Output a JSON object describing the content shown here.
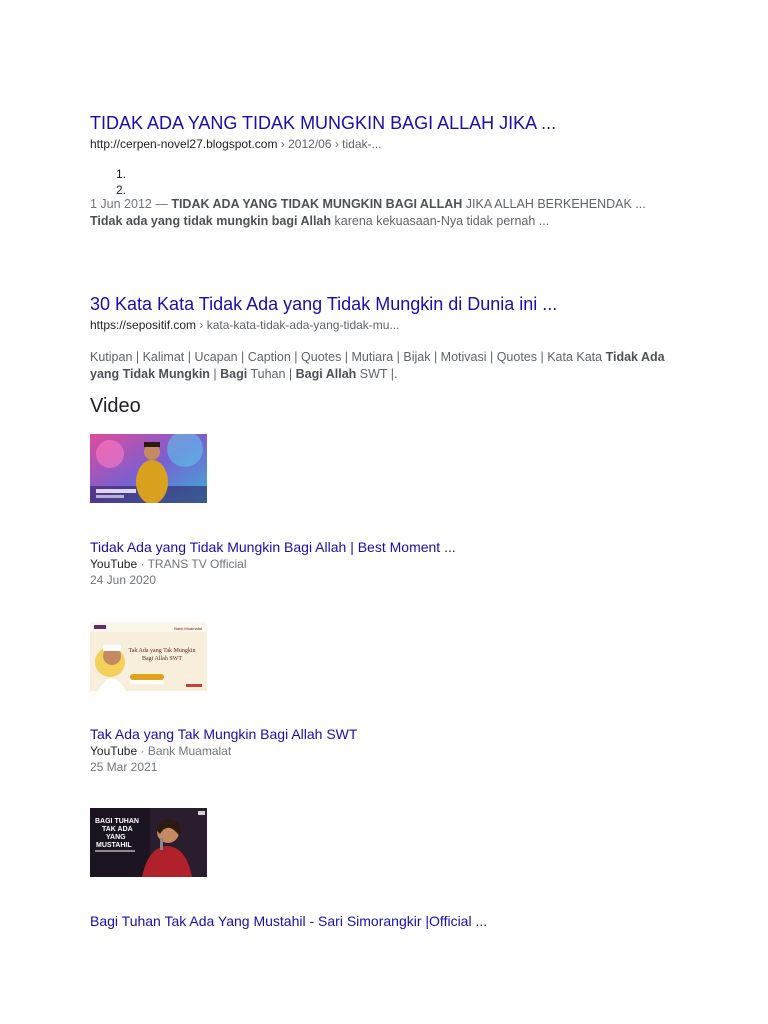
{
  "results": [
    {
      "title": "TIDAK ADA YANG TIDAK MUNGKIN BAGI ALLAH JIKA ...",
      "url_host": "http://cerpen-novel27.blogspot.com",
      "url_path": " › 2012/06 › tidak-...",
      "list_items": [
        "1.",
        "2."
      ],
      "date": "1 Jun 2012 — ",
      "snippet_parts": [
        {
          "t": "TIDAK ADA YANG TIDAK MUNGKIN BAGI ALLAH",
          "b": true
        },
        {
          "t": " JIKA ALLAH BERKEHENDAK ... ",
          "b": false
        },
        {
          "t": "Tidak ada yang tidak mungkin bagi Allah",
          "b": true
        },
        {
          "t": " karena kekuasaan-Nya tidak pernah ...",
          "b": false
        }
      ]
    },
    {
      "title": "30 Kata Kata Tidak Ada yang Tidak Mungkin di Dunia ini ...",
      "url_host": "https://sepositif.com",
      "url_path": " › kata-kata-tidak-ada-yang-tidak-mu...",
      "snippet_parts": [
        {
          "t": "Kutipan | Kalimat | Ucapan | Caption | Quotes | Mutiara | Bijak | Motivasi | Quotes | Kata Kata ",
          "b": false
        },
        {
          "t": "Tidak Ada yang Tidak Mungkin",
          "b": true
        },
        {
          "t": " | ",
          "b": false
        },
        {
          "t": "Bagi",
          "b": true
        },
        {
          "t": " Tuhan | ",
          "b": false
        },
        {
          "t": "Bagi Allah",
          "b": true
        },
        {
          "t": " SWT |.",
          "b": false
        }
      ]
    }
  ],
  "video_section": {
    "heading": "Video",
    "videos": [
      {
        "title": "Tidak Ada yang Tidak Mungkin Bagi Allah | Best Moment ...",
        "site": "YouTube",
        "channel": " · TRANS TV Official",
        "date": "24 Jun 2020",
        "thumb_colors": {
          "bg": "#c73b8a",
          "accent": "#3ab0d6",
          "figure": "#d9a21e"
        }
      },
      {
        "title": "Tak Ada yang Tak Mungkin Bagi Allah SWT",
        "site": "YouTube",
        "channel": " · Bank Muamalat",
        "date": "25 Mar 2021",
        "thumb_text": [
          "Tak Ada yang Tak Mungkin",
          "Bagi Allah SWT"
        ],
        "thumb_brand": "Bank Muamalat",
        "thumb_colors": {
          "bg": "#f7eedb",
          "accent": "#e0a21a",
          "figure": "#6b2a2a"
        }
      },
      {
        "title": "Bagi Tuhan Tak Ada Yang Mustahil - Sari Simorangkir |Official ...",
        "thumb_text": [
          "BAGI TUHAN",
          "TAK ADA",
          "YANG",
          "MUSTAHIL"
        ],
        "thumb_colors": {
          "bg": "#1c1420",
          "accent": "#ffffff",
          "figure": "#b0212b"
        }
      }
    ]
  }
}
